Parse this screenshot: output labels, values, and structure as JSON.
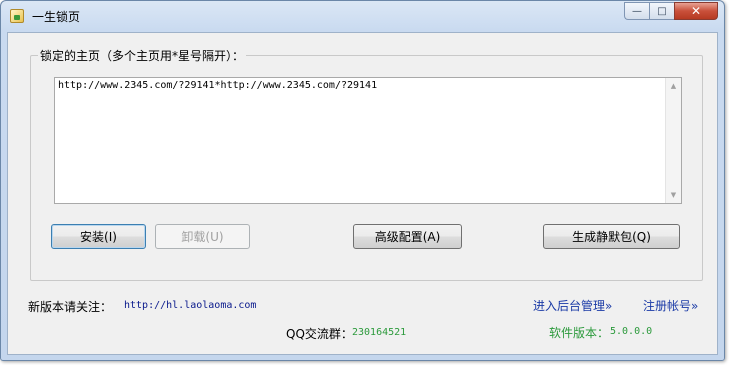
{
  "window": {
    "title": "一生锁页",
    "controls": {
      "minimize": "—",
      "maximize": "□",
      "close": "✕"
    }
  },
  "homepage_group": {
    "label": "锁定的主页（多个主页用*星号隔开）：",
    "urls_value": "http://www.2345.com/?29141*http://www.2345.com/?29141"
  },
  "buttons": {
    "install": "安装(I)",
    "uninstall": "卸载(U)",
    "advanced": "高级配置(A)",
    "silent_package": "生成静默包(Q)"
  },
  "footer": {
    "notice_label": "新版本请关注：",
    "notice_url": "http://hl.laolaoma.com",
    "admin_link": "进入后台管理»",
    "register_link": "注册帐号»",
    "qq_label": "QQ交流群：",
    "qq_number": "230164521",
    "version_label": "软件版本：",
    "version": "5.0.0.0"
  },
  "colors": {
    "link_blue": "#1f3ea8",
    "url_navy": "#0a1a8c",
    "green": "#2c9a3c",
    "admin_blue": "#1a3aa6"
  },
  "icons": {
    "app": "app-icon",
    "scroll_up": "scroll-up-arrow-icon",
    "scroll_down": "scroll-down-arrow-icon"
  }
}
